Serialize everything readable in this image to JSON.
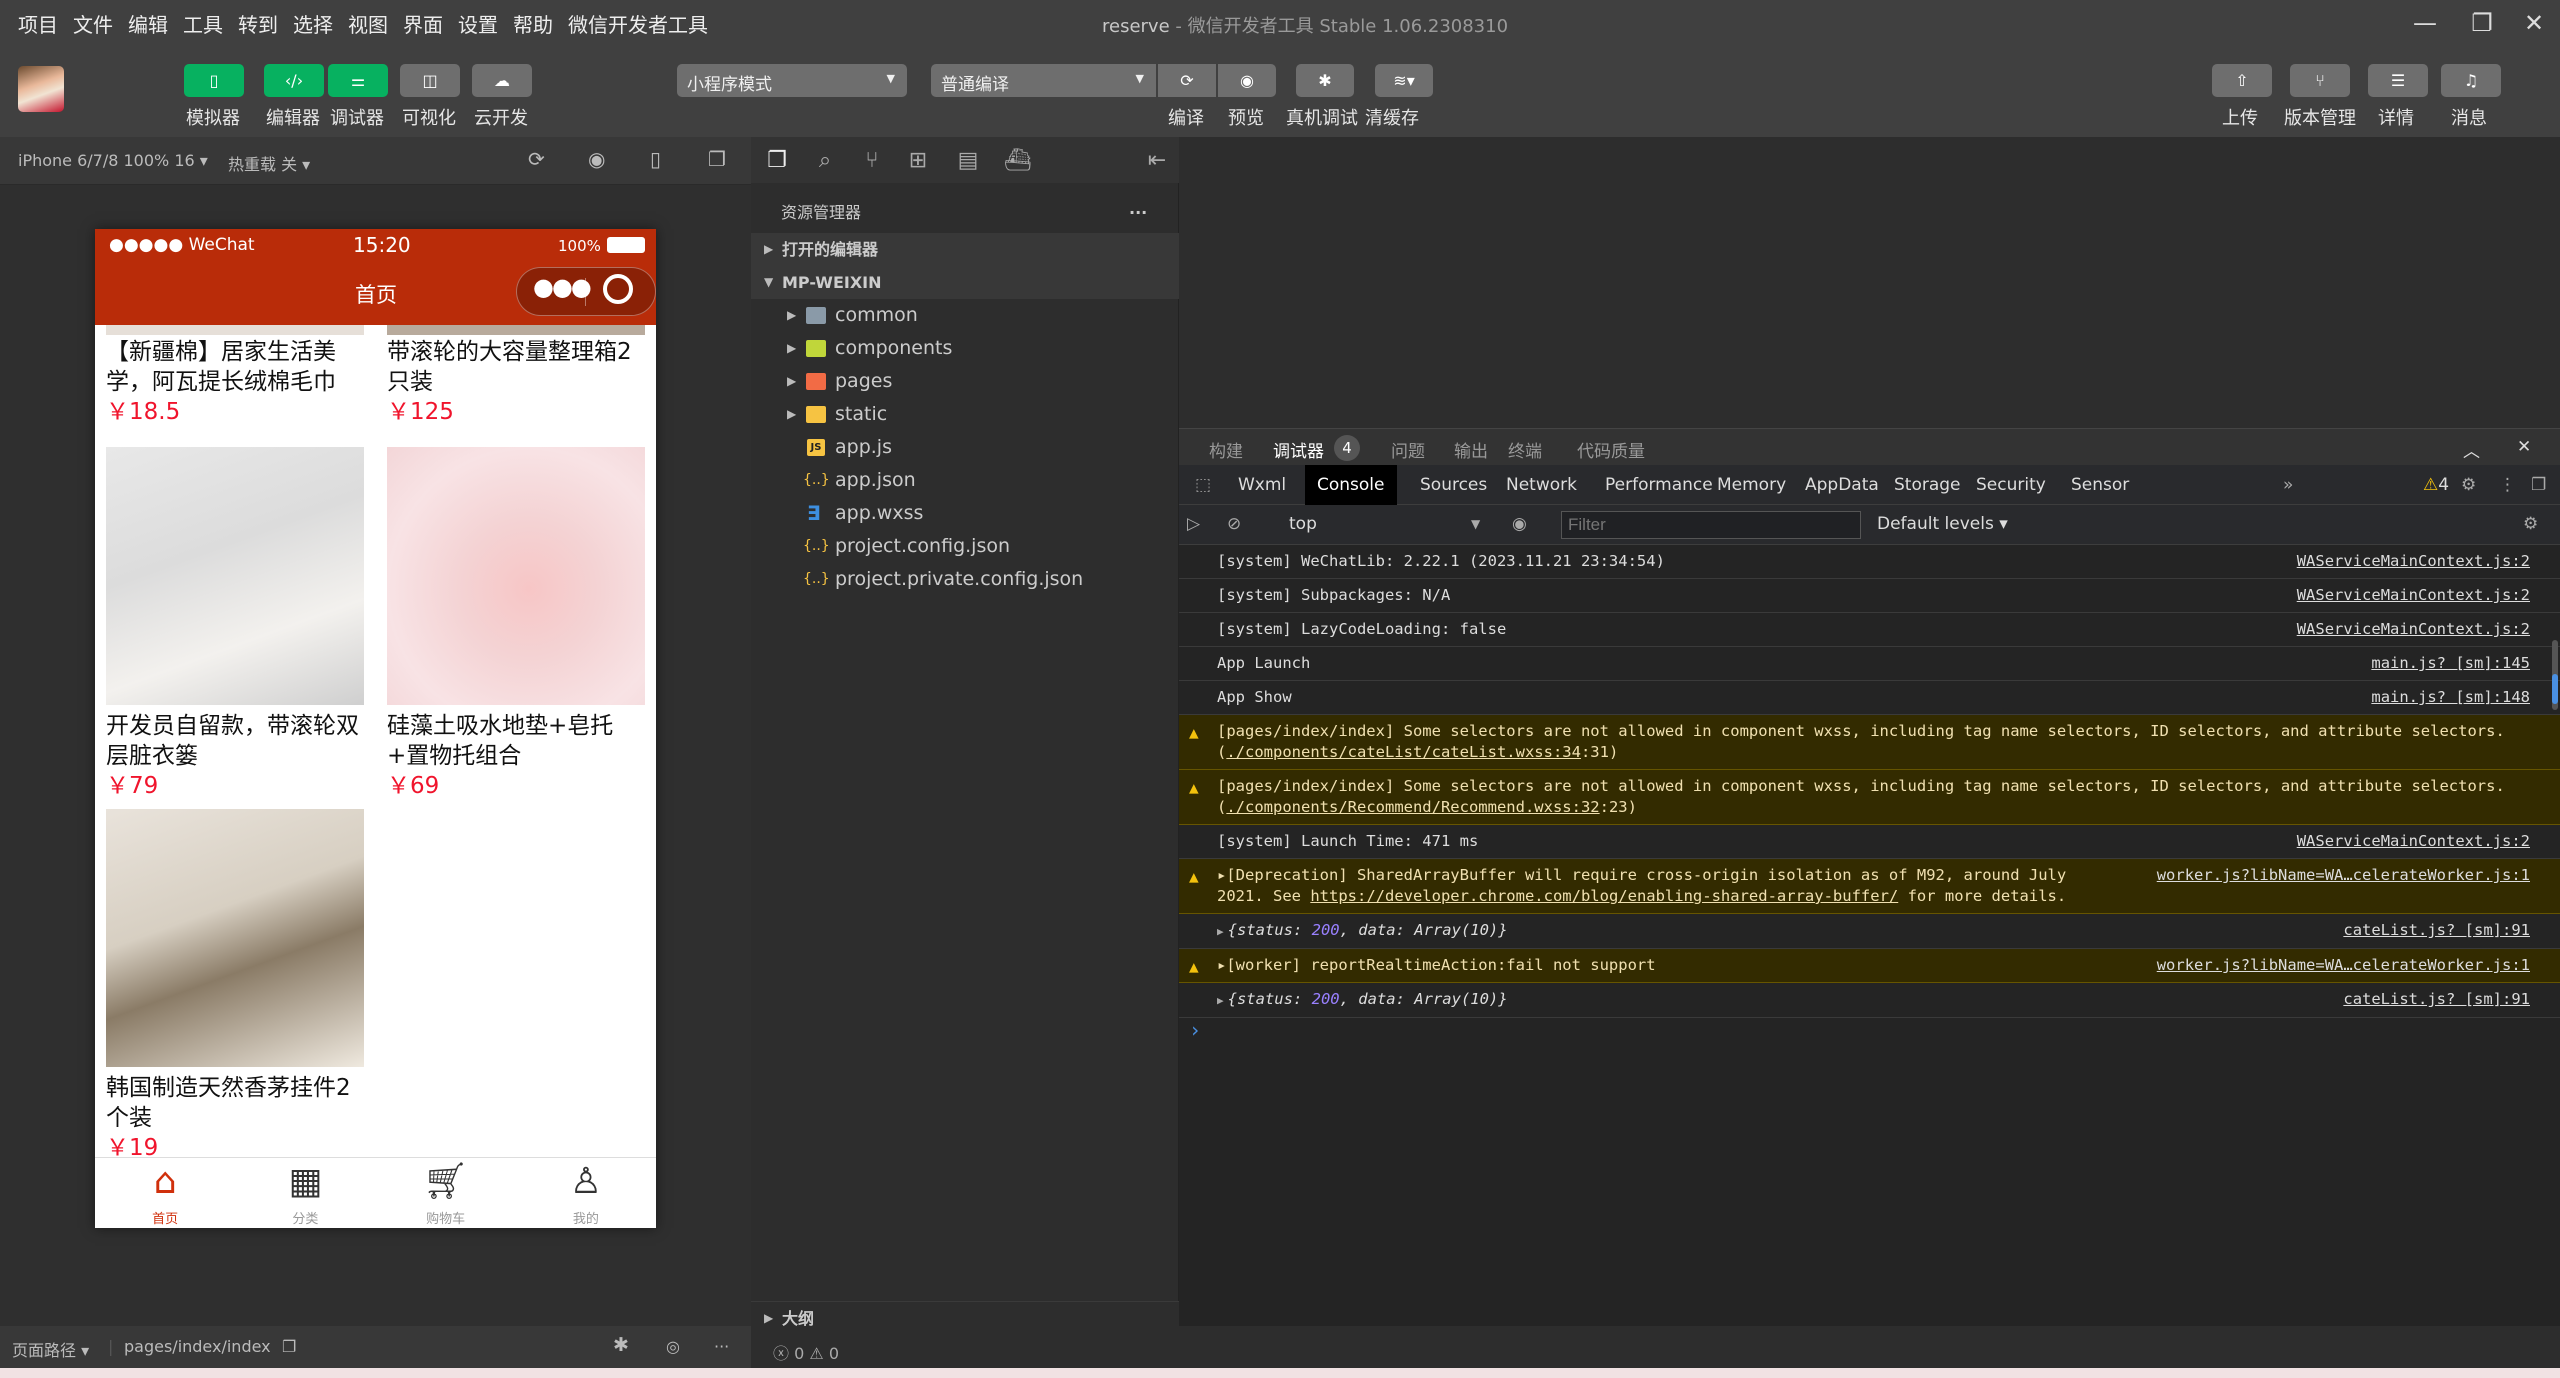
{
  "menu": [
    "项目",
    "文件",
    "编辑",
    "工具",
    "转到",
    "选择",
    "视图",
    "界面",
    "设置",
    "帮助",
    "微信开发者工具"
  ],
  "window_title": {
    "project": "reserve",
    "rest": " - 微信开发者工具 Stable 1.06.2308310"
  },
  "toolbar": {
    "left_buttons": [
      {
        "label": "模拟器",
        "icon": "phone-icon",
        "glyph": "▯",
        "active": true
      },
      {
        "label": "编辑器",
        "icon": "code-icon",
        "glyph": "‹/›",
        "active": true
      },
      {
        "label": "调试器",
        "icon": "debug-sliders-icon",
        "glyph": "⚌",
        "active": true
      },
      {
        "label": "可视化",
        "icon": "layout-icon",
        "glyph": "◫",
        "active": false
      },
      {
        "label": "云开发",
        "icon": "cloud-icon",
        "glyph": "☁",
        "active": false
      }
    ],
    "mode_select": "小程序模式",
    "compile_select": "普通编译",
    "center_buttons": [
      {
        "label": "编译",
        "icon": "refresh-icon",
        "glyph": "⟳"
      },
      {
        "label": "预览",
        "icon": "eye-icon",
        "glyph": "◉"
      },
      {
        "label": "真机调试",
        "icon": "bug-icon",
        "glyph": "✱"
      },
      {
        "label": "清缓存",
        "icon": "layers-icon",
        "glyph": "≋▾"
      }
    ],
    "right_buttons": [
      {
        "label": "上传",
        "icon": "upload-icon",
        "glyph": "⇧"
      },
      {
        "label": "版本管理",
        "icon": "branch-icon",
        "glyph": "⑂"
      },
      {
        "label": "详情",
        "icon": "menu-icon",
        "glyph": "☰"
      },
      {
        "label": "消息",
        "icon": "bell-icon",
        "glyph": "♫"
      }
    ]
  },
  "simulator": {
    "device": "iPhone 6/7/8 100% 16 ▾",
    "hot_reload": "热重载 关 ▾",
    "phone": {
      "carrier": "●●●●● WeChat",
      "time": "15:20",
      "battery": "100%",
      "nav_title": "首页",
      "products": [
        {
          "name": "【新疆棉】居家生活美学，阿瓦提长绒棉毛巾",
          "price": "￥18.5"
        },
        {
          "name": "带滚轮的大容量整理箱2只装",
          "price": "￥125"
        },
        {
          "name": "开发员自留款，带滚轮双层脏衣篓",
          "price": "￥79"
        },
        {
          "name": "硅藻土吸水地垫+皂托+置物托组合",
          "price": "￥69"
        },
        {
          "name": "韩国制造天然香茅挂件2个装",
          "price": "￥19"
        }
      ],
      "tabs": [
        {
          "label": "首页",
          "active": true
        },
        {
          "label": "分类",
          "active": false
        },
        {
          "label": "购物车",
          "active": false
        },
        {
          "label": "我的",
          "active": false
        }
      ]
    },
    "page_path_label": "页面路径 ▾",
    "page_path": "pages/index/index"
  },
  "explorer": {
    "title": "资源管理器",
    "open_editors": "打开的编辑器",
    "root": "MP-WEIXIN",
    "items": [
      {
        "name": "common",
        "type": "folder",
        "color": "#8a9aa8"
      },
      {
        "name": "components",
        "type": "folder",
        "color": "#c0d63a"
      },
      {
        "name": "pages",
        "type": "folder",
        "color": "#f26b45"
      },
      {
        "name": "static",
        "type": "folder",
        "color": "#f6c342"
      },
      {
        "name": "app.js",
        "type": "js"
      },
      {
        "name": "app.json",
        "type": "json"
      },
      {
        "name": "app.wxss",
        "type": "css"
      },
      {
        "name": "project.config.json",
        "type": "json"
      },
      {
        "name": "project.private.config.json",
        "type": "json"
      }
    ],
    "outline": "大纲",
    "problems": {
      "errors": "0",
      "warnings": "0"
    }
  },
  "devtools": {
    "top_tabs": [
      "构建",
      "调试器",
      "问题",
      "输出",
      "终端",
      "代码质量"
    ],
    "active_top_tab": "调试器",
    "debugger_badge": "4",
    "panel_tabs": [
      "Wxml",
      "Console",
      "Sources",
      "Network",
      "Performance",
      "Memory",
      "AppData",
      "Storage",
      "Security",
      "Sensor"
    ],
    "active_panel_tab": "Console",
    "more_tabs": "»",
    "warning_count": "4",
    "context": "top",
    "filter_placeholder": "Filter",
    "levels": "Default levels ▾",
    "logs": [
      {
        "level": "info",
        "text": "[system] WeChatLib: 2.22.1 (2023.11.21 23:34:54)",
        "source": "WAServiceMainContext.js:2"
      },
      {
        "level": "info",
        "text": "[system] Subpackages: N/A",
        "source": "WAServiceMainContext.js:2"
      },
      {
        "level": "info",
        "text": "[system] LazyCodeLoading: false",
        "source": "WAServiceMainContext.js:2"
      },
      {
        "level": "info",
        "text": "App Launch",
        "source": "main.js? [sm]:145"
      },
      {
        "level": "info",
        "text": "App Show",
        "source": "main.js? [sm]:148"
      },
      {
        "level": "warn",
        "text": "[pages/index/index] Some selectors are not allowed in component wxss, including tag name selectors, ID selectors, and attribute selectors.(",
        "link": "./components/cateList/cateList.wxss:34",
        "tail": ":31)",
        "source": ""
      },
      {
        "level": "warn",
        "text": "[pages/index/index] Some selectors are not allowed in component wxss, including tag name selectors, ID selectors, and attribute selectors.(",
        "link": "./components/Recommend/Recommend.wxss:32",
        "tail": ":23)",
        "source": ""
      },
      {
        "level": "info",
        "text": "[system] Launch Time: 471 ms",
        "source": "WAServiceMainContext.js:2"
      },
      {
        "level": "warn",
        "text": "▸[Deprecation] SharedArrayBuffer will require cross-origin isolation as of M92, around July 2021. See ",
        "link": "https://developer.chrome.com/blog/enabling-shared-array-buffer/",
        "tail": " for more details.",
        "source": "worker.js?libName=WA…celerateWorker.js:1"
      },
      {
        "level": "obj",
        "text": "{status: 200, data: Array(10)}",
        "source": "cateList.js? [sm]:91"
      },
      {
        "level": "warn",
        "text": "▸[worker] reportRealtimeAction:fail not support",
        "source": "worker.js?libName=WA…celerateWorker.js:1"
      },
      {
        "level": "obj",
        "text": "{status: 200, data: Array(10)}",
        "source": "cateList.js? [sm]:91"
      }
    ],
    "prompt": "›"
  }
}
